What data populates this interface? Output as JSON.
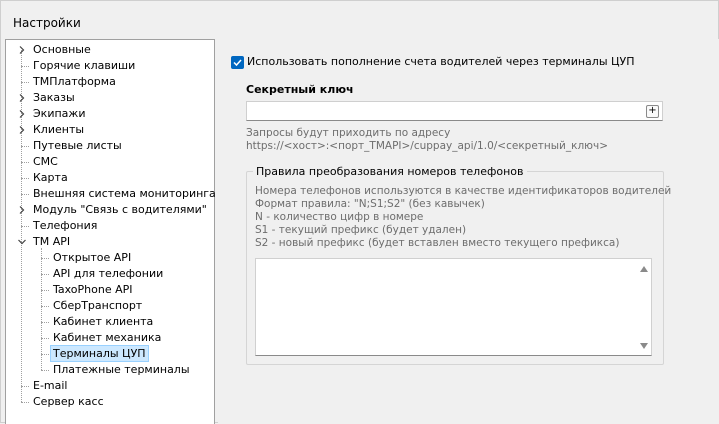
{
  "window": {
    "title": "Настройки"
  },
  "tree": {
    "items": [
      {
        "label": "Основные",
        "expandable": true
      },
      {
        "label": "Горячие клавиши"
      },
      {
        "label": "ТМПлатформа"
      },
      {
        "label": "Заказы",
        "expandable": true
      },
      {
        "label": "Экипажи",
        "expandable": true
      },
      {
        "label": "Клиенты",
        "expandable": true
      },
      {
        "label": "Путевые листы"
      },
      {
        "label": "СМС"
      },
      {
        "label": "Карта"
      },
      {
        "label": "Внешняя система мониторинга"
      },
      {
        "label": "Модуль \"Связь с водителями\"",
        "expandable": true
      },
      {
        "label": "Телефония"
      },
      {
        "label": "TM API",
        "expanded": true
      },
      {
        "label": "Открытое API",
        "child": true
      },
      {
        "label": "API для телефонии",
        "child": true
      },
      {
        "label": "TaxoPhone API",
        "child": true
      },
      {
        "label": "СберТранспорт",
        "child": true
      },
      {
        "label": "Кабинет клиента",
        "child": true
      },
      {
        "label": "Кабинет механика",
        "child": true
      },
      {
        "label": "Терминалы ЦУП",
        "child": true,
        "selected": true
      },
      {
        "label": "Платежные терминалы",
        "child": true
      },
      {
        "label": "E-mail"
      },
      {
        "label": "Сервер касс"
      }
    ]
  },
  "panel": {
    "checkbox_label": "Использовать пополнение счета водителей через терминалы ЦУП",
    "checkbox_checked": true,
    "secret_key_title": "Секретный ключ",
    "secret_key_value": "",
    "plus_icon": "+",
    "hint_line1": "Запросы будут приходить по адресу",
    "hint_line2": "https://<хост>:<порт_TMAPI>/cuppay_api/1.0/<секретный_ключ>",
    "group_title": "Правила преобразования номеров телефонов",
    "group_lines": [
      "Номера телефонов используются в качестве идентификаторов водителей",
      "Формат правила: \"N;S1;S2\" (без кавычек)",
      "N - количество цифр в номере",
      "S1 - текущий префикс (будет удален)",
      "S2 - новый префикс (будет вставлен вместо текущего префикса)"
    ],
    "rules_value": ""
  },
  "colors": {
    "accent": "#0067c0",
    "selection": "#cce8ff",
    "hint_text": "#6d6d6d"
  }
}
